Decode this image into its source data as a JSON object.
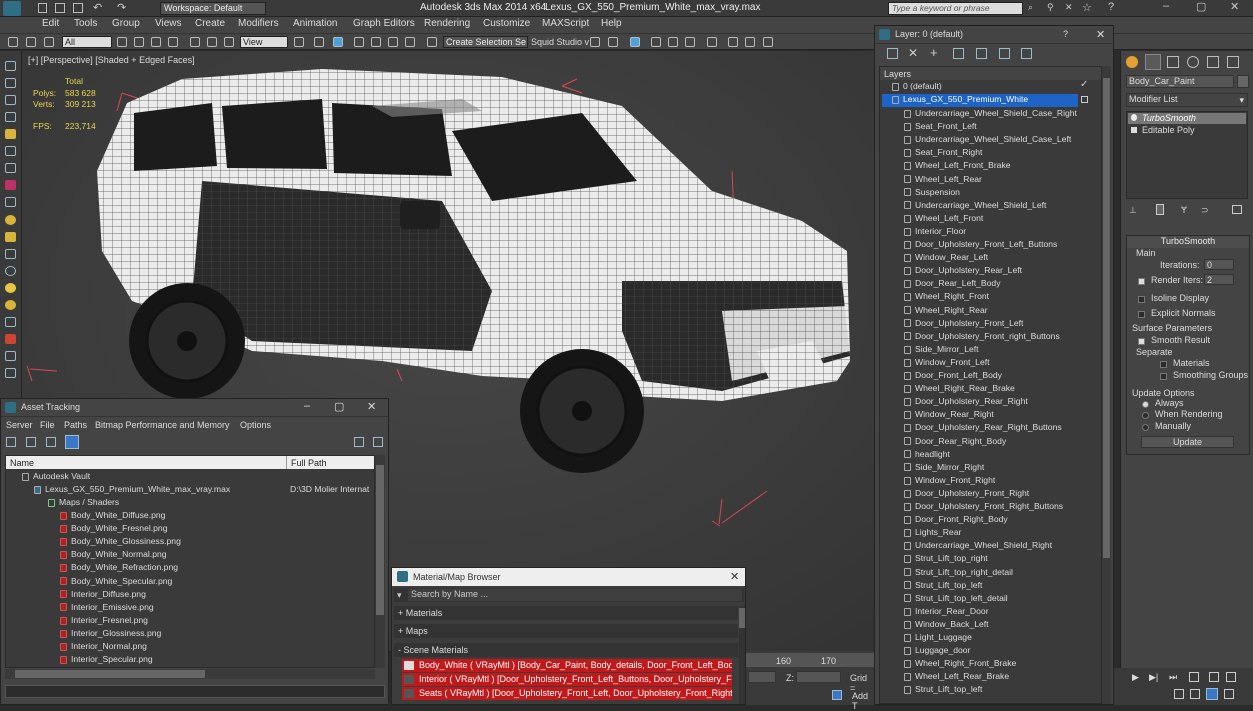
{
  "titlebar": {
    "app_title": "Autodesk 3ds Max  2014 x64",
    "file_title": "Lexus_GX_550_Premium_White_max_vray.max",
    "workspace": "Workspace: Default",
    "search_placeholder": "Type a keyword or phrase"
  },
  "menu": [
    "Edit",
    "Tools",
    "Group",
    "Views",
    "Create",
    "Modifiers",
    "Animation",
    "Graph Editors",
    "Rendering",
    "Customize",
    "MAXScript",
    "Help"
  ],
  "toolbar": {
    "filter": "All",
    "view": "View",
    "selection_set": "Create Selection Se",
    "squid": "Squid Studio v"
  },
  "viewport": {
    "label": "[+] [Perspective] [Shaded + Edged Faces]",
    "stats_header": "Total",
    "polys_label": "Polys:",
    "polys_value": "583 628",
    "verts_label": "Verts:",
    "verts_value": "309 213",
    "fps_label": "FPS:",
    "fps_value": "223,714"
  },
  "layer_window": {
    "title": "Layer: 0 (default)",
    "help": "?",
    "header": "Layers",
    "default_layer": "0 (default)",
    "selected_layer": "Lexus_GX_550_Premium_White",
    "objects": [
      "Undercarriage_Wheel_Shield_Case_Right",
      "Seat_Front_Left",
      "Undercarriage_Wheel_Shield_Case_Left",
      "Seat_Front_Right",
      "Wheel_Left_Front_Brake",
      "Wheel_Left_Rear",
      "Suspension",
      "Undercarriage_Wheel_Shield_Left",
      "Wheel_Left_Front",
      "Interior_Floor",
      "Door_Upholstery_Front_Left_Buttons",
      "Window_Rear_Left",
      "Door_Upholstery_Rear_Left",
      "Door_Rear_Left_Body",
      "Wheel_Right_Front",
      "Wheel_Right_Rear",
      "Door_Upholstery_Front_Left",
      "Door_Upholstery_Front_right_Buttons",
      "Side_Mirror_Left",
      "Window_Front_Left",
      "Door_Front_Left_Body",
      "Wheel_Right_Rear_Brake",
      "Door_Upholstery_Rear_Right",
      "Window_Rear_Right",
      "Door_Upholstery_Rear_Right_Buttons",
      "Door_Rear_Right_Body",
      "headlight",
      "Side_Mirror_Right",
      "Window_Front_Right",
      "Door_Upholstery_Front_Right",
      "Door_Upholstery_Front_Right_Buttons",
      "Door_Front_Right_Body",
      "Lights_Rear",
      "Undercarriage_Wheel_Shield_Right",
      "Strut_Lift_top_right",
      "Strut_Lift_top_right_detail",
      "Strut_Lift_top_left",
      "Strut_Lift_top_left_detail",
      "Interior_Rear_Door",
      "Window_Back_Left",
      "Light_Luggage",
      "Luggage_door",
      "Wheel_Right_Front_Brake",
      "Wheel_Left_Rear_Brake",
      "Strut_Lift_top_left"
    ]
  },
  "modify_panel": {
    "object_name": "Body_Car_Paint",
    "modifier_list": "Modifier List",
    "stack": [
      "TurboSmooth",
      "Editable Poly"
    ],
    "rollout_title": "TurboSmooth",
    "main_label": "Main",
    "iterations_label": "Iterations:",
    "iterations_value": "0",
    "render_iters_label": "Render Iters:",
    "render_iters_value": "2",
    "isoline": "Isoline Display",
    "explicit": "Explicit Normals",
    "surface_params": "Surface Parameters",
    "smooth_result": "Smooth Result",
    "separate": "Separate",
    "materials": "Materials",
    "smoothing_groups": "Smoothing Groups",
    "update_options": "Update Options",
    "always": "Always",
    "when_rendering": "When Rendering",
    "manually": "Manually",
    "update_button": "Update"
  },
  "asset_tracking": {
    "title": "Asset Tracking",
    "menu": [
      "Server",
      "File",
      "Paths",
      "Bitmap Performance and Memory",
      "Options"
    ],
    "col_name": "Name",
    "col_path": "Full Path",
    "vault": "Autodesk Vault",
    "file": "Lexus_GX_550_Premium_White_max_vray.max",
    "file_path": "D:\\3D Molier Internat",
    "maps_group": "Maps / Shaders",
    "maps": [
      "Body_White_Diffuse.png",
      "Body_White_Fresnel.png",
      "Body_White_Glossiness.png",
      "Body_White_Normal.png",
      "Body_White_Refraction.png",
      "Body_White_Specular.png",
      "Interior_Diffuse.png",
      "Interior_Emissive.png",
      "Interior_Fresnel.png",
      "Interior_Glossiness.png",
      "Interior_Normal.png",
      "Interior_Specular.png"
    ]
  },
  "material_browser": {
    "title": "Material/Map Browser",
    "search_placeholder": "Search by Name ...",
    "sections": [
      "+ Materials",
      "+ Maps",
      "- Scene Materials"
    ],
    "scene_materials": [
      "Body_White ( VRayMtl ) [Body_Car_Paint, Body_details, Door_Front_Left_Body,...",
      "Interior ( VRayMtl ) [Door_Upholstery_Front_Left_Buttons, Door_Upholstery_Fr...",
      "Seats ( VRayMtl ) [Door_Upholstery_Front_Left, Door_Upholstery_Front_Right,..."
    ]
  },
  "timeline": {
    "ticks": [
      "160",
      "170"
    ],
    "z_label": "Z:",
    "grid_label": "Grid =",
    "add_t": "Add T"
  },
  "colors": {
    "selection_blue": "#1e63c6",
    "material_red": "#c0191b",
    "bbox_red": "#d6485a"
  }
}
